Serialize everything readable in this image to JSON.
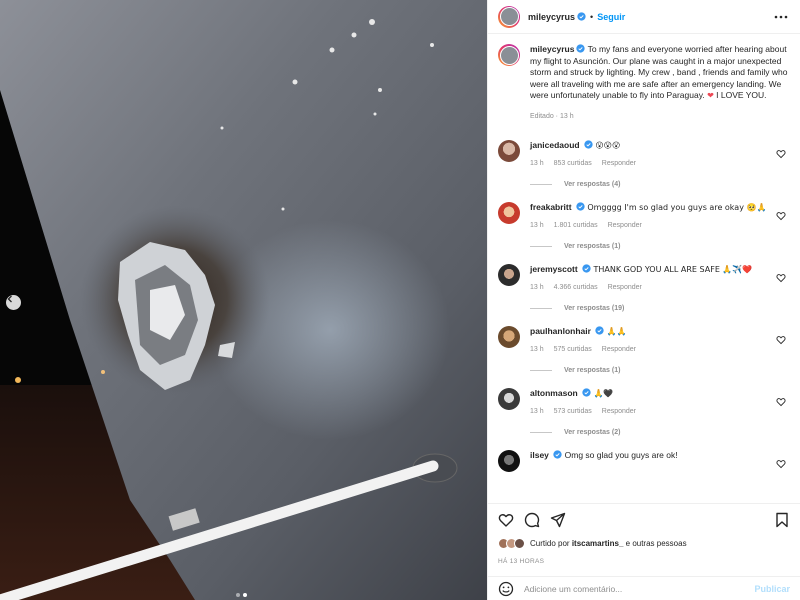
{
  "post": {
    "username": "mileycyrus",
    "separator": "•",
    "follow_label": "Seguir",
    "caption_username": "mileycyrus",
    "caption_text": "To my fans and everyone worried after hearing about my flight to Asunción. Our plane was caught in a major unexpected storm and struck by lighting. My crew , band , friends and family who were all traveling with me are safe after an emergency landing. We were unfortunately unable to fly into Paraguay.",
    "caption_emoji": "❤",
    "caption_tail": "I LOVE YOU.",
    "caption_meta": "Editado · 13 h"
  },
  "comments": [
    {
      "user": "janicedaoud",
      "text": "😮😮😮",
      "time": "13 h",
      "likes": "853 curtidas",
      "reply": "Responder",
      "view_replies": "Ver respostas (4)"
    },
    {
      "user": "freakabritt",
      "text": "Omgggg I'm so glad you guys are okay 🥺🙏",
      "time": "13 h",
      "likes": "1.801 curtidas",
      "reply": "Responder",
      "view_replies": "Ver respostas (1)"
    },
    {
      "user": "jeremyscott",
      "text": "THANK GOD YOU ALL ARE SAFE 🙏✈️❤️",
      "time": "13 h",
      "likes": "4.366 curtidas",
      "reply": "Responder",
      "view_replies": "Ver respostas (19)"
    },
    {
      "user": "paulhanlonhair",
      "text": "🙏🙏",
      "time": "13 h",
      "likes": "575 curtidas",
      "reply": "Responder",
      "view_replies": "Ver respostas (1)"
    },
    {
      "user": "altonmason",
      "text": "🙏🖤",
      "time": "13 h",
      "likes": "573 curtidas",
      "reply": "Responder",
      "view_replies": "Ver respostas (2)"
    },
    {
      "user": "ilsey",
      "text": "Omg so glad you guys are ok!",
      "time": "",
      "likes": "",
      "reply": "",
      "view_replies": ""
    }
  ],
  "liked_by": {
    "prefix": "Curtido por",
    "user": "itscamartins_",
    "suffix": "e outras pessoas"
  },
  "timestamp": "HÁ 13 HORAS",
  "add_comment": {
    "placeholder": "Adicione um comentário...",
    "post_label": "Publicar"
  },
  "icons": {
    "more": "more-horizontal-icon",
    "heart": "heart-icon",
    "comment": "comment-icon",
    "share": "share-icon",
    "bookmark": "bookmark-icon",
    "emoji": "emoji-icon",
    "carousel_prev": "chevron-left-icon",
    "verified": "verified-badge-icon"
  },
  "colors": {
    "accent": "#0095f6",
    "verified": "#3897f0",
    "heart_red": "#ed4956",
    "muted": "#8e8e8e"
  }
}
